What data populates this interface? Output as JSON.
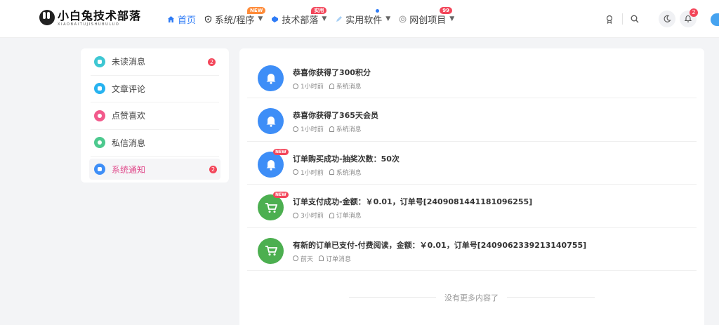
{
  "brand": {
    "title": "小白兔技术部落",
    "subtitle": "XIAOBAITUJISHUBULUO"
  },
  "nav": {
    "items": [
      {
        "label": "首页",
        "icon": "home-icon",
        "color": "#2f7cf6"
      },
      {
        "label": "系统/程序",
        "icon": "shield-icon",
        "badge": "NEW"
      },
      {
        "label": "技术部落",
        "icon": "tag-icon",
        "badge": "实用"
      },
      {
        "label": "实用软件",
        "icon": "pen-icon"
      },
      {
        "label": "网创项目",
        "icon": "coin-icon",
        "badge": "99"
      }
    ]
  },
  "header": {
    "notification_count": "2"
  },
  "sidebar": {
    "items": [
      {
        "label": "未读消息",
        "icon": "chat-icon",
        "color": "#3ec7d3",
        "badge": "2"
      },
      {
        "label": "文章评论",
        "icon": "comment-icon",
        "color": "#27b3f0"
      },
      {
        "label": "点赞喜欢",
        "icon": "heart-icon",
        "color": "#f25a8c"
      },
      {
        "label": "私信消息",
        "icon": "message-icon",
        "color": "#4cc98e"
      },
      {
        "label": "系统通知",
        "icon": "bell-icon",
        "color": "#3e8ef7",
        "badge": "2",
        "active": true
      }
    ]
  },
  "messages": [
    {
      "title": "恭喜你获得了300积分",
      "time": "1小时前",
      "type": "系统消息",
      "icon": "bell-icon",
      "new": false
    },
    {
      "title": "恭喜你获得了365天会员",
      "time": "1小时前",
      "type": "系统消息",
      "icon": "bell-icon",
      "new": false
    },
    {
      "title": "订单购买成功-抽奖次数：50次",
      "time": "1小时前",
      "type": "系统消息",
      "icon": "bell-icon",
      "new": true
    },
    {
      "title": "订单支付成功-金额：￥0.01，订单号[2409081441181096255]",
      "time": "3小时前",
      "type": "订单消息",
      "icon": "cart-icon",
      "new": true
    },
    {
      "title": "有新的订单已支付-付费阅读，金额：￥0.01，订单号[2409062339213140755]",
      "time": "前天",
      "type": "订单消息",
      "icon": "cart-icon",
      "new": false
    }
  ],
  "new_tag": "NEW",
  "end_text": "没有更多内容了"
}
